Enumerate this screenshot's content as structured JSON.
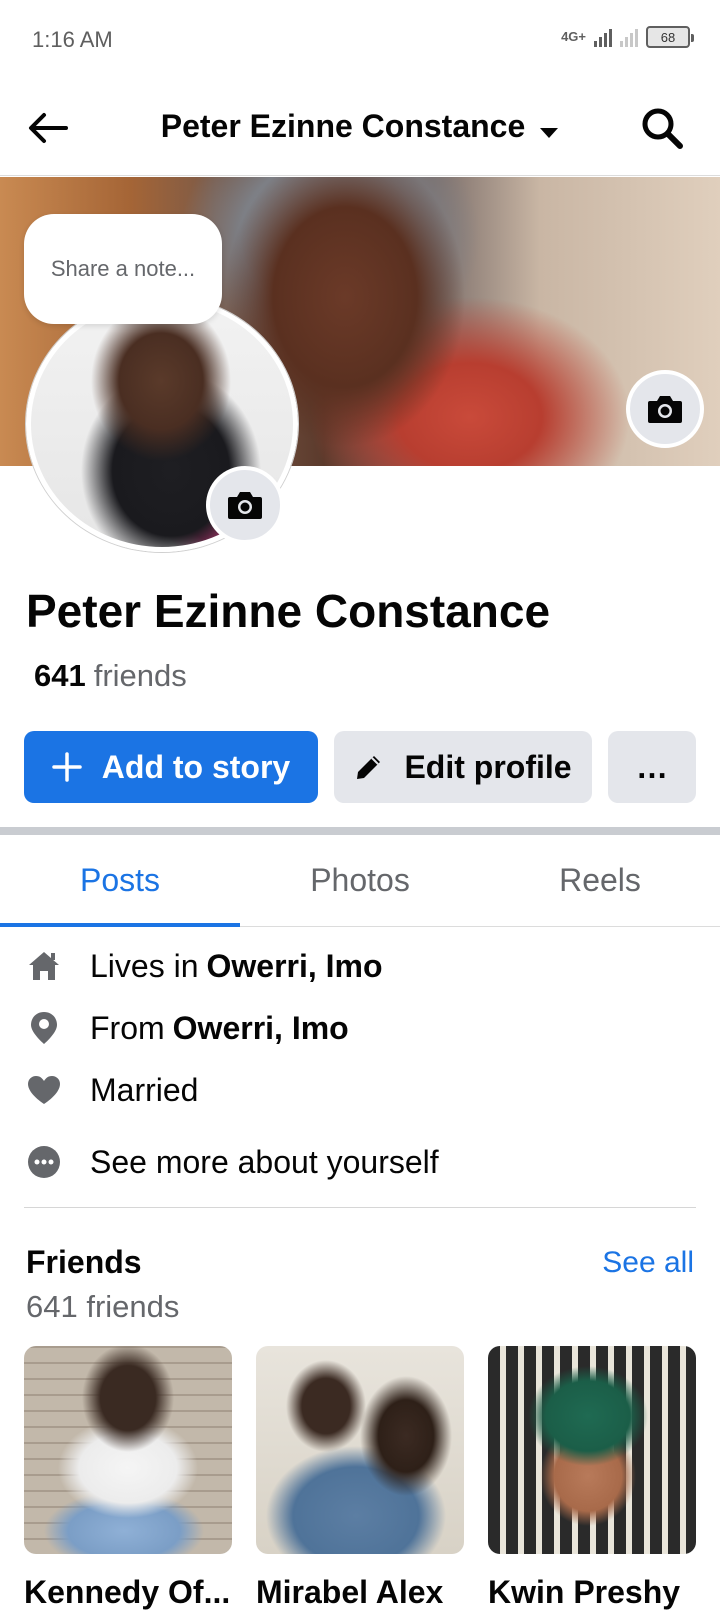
{
  "status_bar": {
    "time": "1:16 AM",
    "network": "4G+",
    "battery": "68"
  },
  "header": {
    "title": "Peter Ezinne Constance"
  },
  "note": {
    "placeholder": "Share a note..."
  },
  "profile": {
    "name": "Peter Ezinne Constance",
    "friends_count": "641",
    "friends_label": "friends"
  },
  "actions": {
    "add_story": "Add to story",
    "edit_profile": "Edit profile",
    "more": "…"
  },
  "tabs": [
    {
      "label": "Posts",
      "active": true
    },
    {
      "label": "Photos",
      "active": false
    },
    {
      "label": "Reels",
      "active": false
    }
  ],
  "details": [
    {
      "icon": "home-icon",
      "prefix": "Lives in",
      "value": "Owerri, Imo"
    },
    {
      "icon": "location-pin-icon",
      "prefix": "From",
      "value": "Owerri, Imo"
    },
    {
      "icon": "heart-icon",
      "prefix": "Married",
      "value": ""
    },
    {
      "icon": "more-dots-icon",
      "prefix": "See more about yourself",
      "value": ""
    }
  ],
  "friends_section": {
    "title": "Friends",
    "see_all": "See all",
    "count": "641 friends",
    "friends": [
      {
        "name": "Kennedy Of..."
      },
      {
        "name": "Mirabel Alex"
      },
      {
        "name": "Kwin Preshy"
      }
    ]
  },
  "colors": {
    "accent": "#1b74e4",
    "secondary_button": "#e4e6eb",
    "muted_text": "#65676b"
  }
}
